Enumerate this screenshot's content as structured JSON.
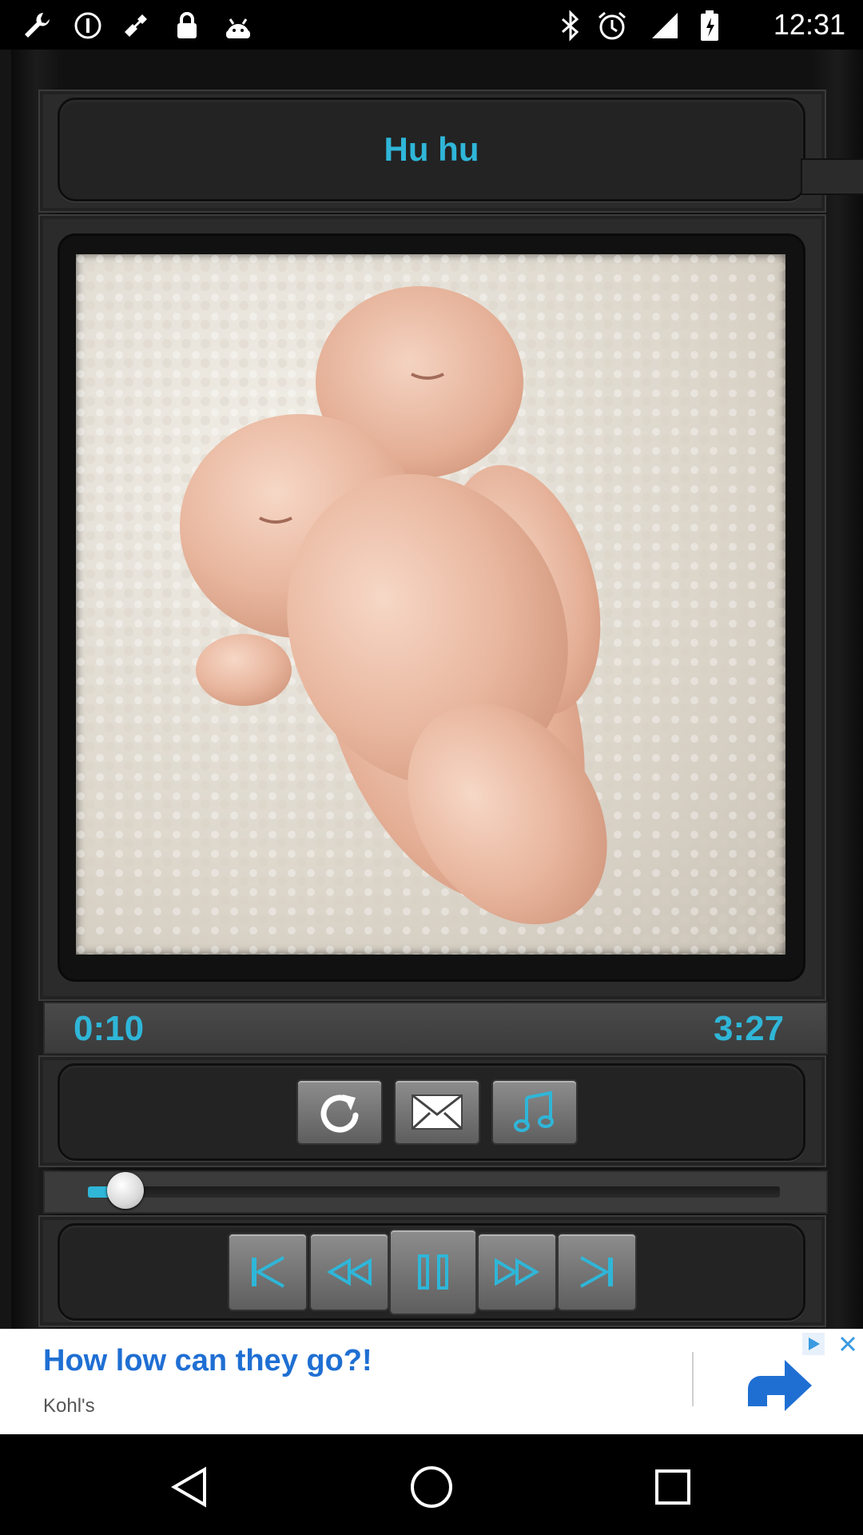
{
  "status_bar": {
    "time": "12:31",
    "left_icons": [
      "wrench-icon",
      "circle-alert-icon",
      "fake-gps-icon",
      "lock-icon",
      "android-icon"
    ],
    "right_icons": [
      "bluetooth-icon",
      "alarm-icon",
      "signal-icon",
      "battery-icon"
    ]
  },
  "player": {
    "title": "Hu hu",
    "elapsed": "0:10",
    "duration": "3:27",
    "progress_fraction": 0.035,
    "artwork": "sleeping-babies-photo",
    "accent_color": "#2fb6d8"
  },
  "action_buttons": [
    {
      "name": "repeat-button",
      "icon": "repeat-icon"
    },
    {
      "name": "share-email-button",
      "icon": "mail-icon"
    },
    {
      "name": "music-library-button",
      "icon": "music-note-icon"
    }
  ],
  "playback_buttons": [
    {
      "name": "skip-previous-button",
      "icon": "skip-previous-icon"
    },
    {
      "name": "rewind-button",
      "icon": "rewind-icon"
    },
    {
      "name": "pause-button",
      "icon": "pause-icon"
    },
    {
      "name": "fast-forward-button",
      "icon": "fast-forward-icon"
    },
    {
      "name": "skip-next-button",
      "icon": "skip-next-icon"
    }
  ],
  "ad": {
    "headline": "How low can they go?!",
    "advertiser": "Kohl's",
    "cta_icon": "forward-arrow-icon",
    "close_icon": "close-icon",
    "badge_icon": "ad-choices-icon",
    "headline_color": "#1f6fd3"
  },
  "nav_bar": {
    "buttons": [
      "back-icon",
      "home-icon",
      "recents-icon"
    ]
  }
}
